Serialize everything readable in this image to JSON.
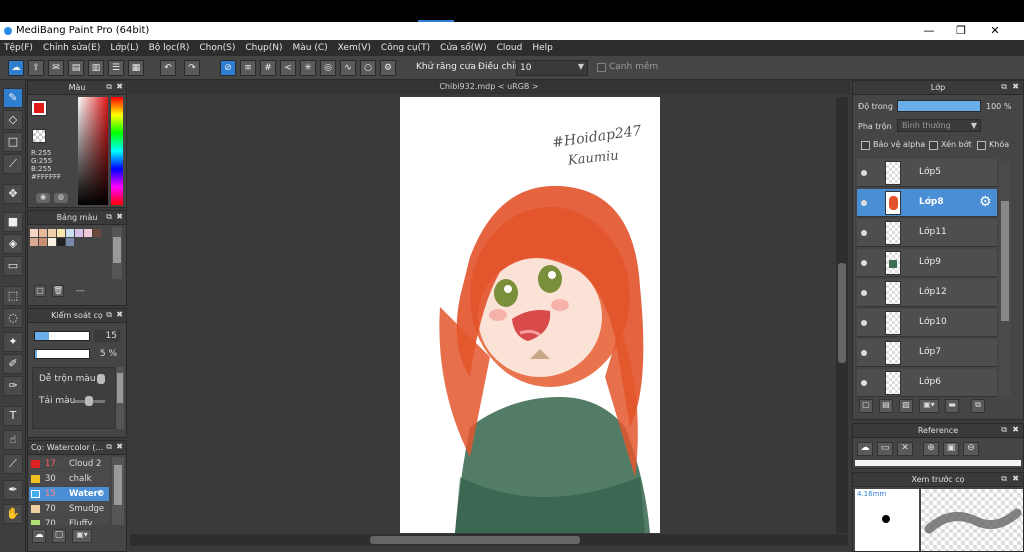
{
  "window": {
    "title": "MediBang Paint Pro (64bit)"
  },
  "menu": [
    "Tệp(F)",
    "Chỉnh sửa(E)",
    "Lớp(L)",
    "Bộ lọc(R)",
    "Chọn(S)",
    "Chụp(N)",
    "Màu (C)",
    "Xem(V)",
    "Công cụ(T)",
    "Cửa sổ(W)",
    "Cloud",
    "Help"
  ],
  "toolbar": {
    "antialias_label": "Khử răng cưa",
    "adjust_label": "Điều chỉnh",
    "adjust_value": "10",
    "smooth_label": "Cạnh mềm"
  },
  "color_panel": {
    "title": "Màu",
    "r": "R:255",
    "g": "G:255",
    "b": "B:255",
    "hex": "#FFFFFF"
  },
  "palette_panel": {
    "title": "Bảng màu",
    "dash": "---"
  },
  "brush_control": {
    "title": "Kiểm soát cọ",
    "size": "15",
    "opacity": "5 %",
    "mix_label": "Dễ trộn màu",
    "load_label": "Tải màu"
  },
  "brush_list": {
    "title": "Cọ: Watercolor (...",
    "items": [
      {
        "num": "17",
        "label": "Cloud 2",
        "color": "#e02020"
      },
      {
        "num": "30",
        "label": "chalk",
        "color": "#f0c020"
      },
      {
        "num": "15",
        "label": "Waterc",
        "color": "#40b0f0"
      },
      {
        "num": "70",
        "label": "Smudge",
        "color": "#f0d0a0"
      },
      {
        "num": "70",
        "label": "Fluffy Wat",
        "color": "#b0e070"
      }
    ]
  },
  "document": {
    "tab": "Chibi932.mdp < uRGB >",
    "watermark_line1": "#Hoidap247",
    "watermark_line2": "Kaumiu"
  },
  "layers_panel": {
    "title": "Lớp",
    "opacity_label": "Độ trong",
    "opacity_value": "100 %",
    "blend_label": "Pha trộn",
    "blend_value": "Bình thường",
    "protect_alpha": "Bảo vệ alpha",
    "clipping": "Xén bớt",
    "lock": "Khóa",
    "layers": [
      "Lớp5",
      "Lớp8",
      "Lớp11",
      "Lớp9",
      "Lớp12",
      "Lớp10",
      "Lớp7",
      "Lớp6"
    ]
  },
  "reference_panel": {
    "title": "Reference"
  },
  "brush_preview": {
    "title": "Xem trước cọ",
    "size": "4.16mm"
  }
}
